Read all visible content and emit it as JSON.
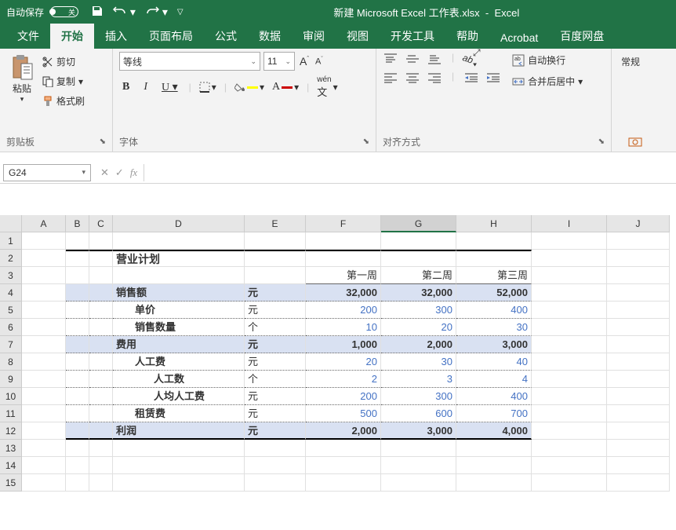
{
  "titleBar": {
    "autosave": "自动保存",
    "toggleState": "关",
    "filename": "新建 Microsoft Excel 工作表.xlsx",
    "appName": "Excel"
  },
  "tabs": [
    "文件",
    "开始",
    "插入",
    "页面布局",
    "公式",
    "数据",
    "审阅",
    "视图",
    "开发工具",
    "帮助",
    "Acrobat",
    "百度网盘"
  ],
  "activeTab": "开始",
  "ribbon": {
    "clipboard": {
      "paste": "粘贴",
      "cut": "剪切",
      "copy": "复制",
      "format": "格式刷",
      "label": "剪贴板"
    },
    "font": {
      "name": "等线",
      "size": "11",
      "label": "字体",
      "wen": "wén"
    },
    "alignment": {
      "wrap": "自动换行",
      "merge": "合并后居中",
      "label": "对齐方式"
    },
    "number": {
      "format": "常规"
    }
  },
  "nameBox": "G24",
  "colHeaders": [
    "A",
    "B",
    "C",
    "D",
    "E",
    "F",
    "G",
    "H",
    "I",
    "J"
  ],
  "rowCount": 15,
  "sheet": {
    "title": "营业计划",
    "weekHeaders": [
      "第一周",
      "第二周",
      "第三周"
    ],
    "rows": [
      {
        "label": "销售额",
        "unit": "元",
        "vals": [
          "32,000",
          "32,000",
          "52,000"
        ],
        "type": "section"
      },
      {
        "label": "单价",
        "unit": "元",
        "vals": [
          "200",
          "300",
          "400"
        ],
        "type": "indent1",
        "blue": true
      },
      {
        "label": "销售数量",
        "unit": "个",
        "vals": [
          "10",
          "20",
          "30"
        ],
        "type": "indent1",
        "blue": true
      },
      {
        "label": "费用",
        "unit": "元",
        "vals": [
          "1,000",
          "2,000",
          "3,000"
        ],
        "type": "section"
      },
      {
        "label": "人工费",
        "unit": "元",
        "vals": [
          "20",
          "30",
          "40"
        ],
        "type": "indent1",
        "blue": true
      },
      {
        "label": "人工数",
        "unit": "个",
        "vals": [
          "2",
          "3",
          "4"
        ],
        "type": "indent2",
        "blue": true
      },
      {
        "label": "人均人工费",
        "unit": "元",
        "vals": [
          "200",
          "300",
          "400"
        ],
        "type": "indent2",
        "blue": true
      },
      {
        "label": "租赁费",
        "unit": "元",
        "vals": [
          "500",
          "600",
          "700"
        ],
        "type": "indent1",
        "blue": true
      },
      {
        "label": "利润",
        "unit": "元",
        "vals": [
          "2,000",
          "3,000",
          "4,000"
        ],
        "type": "section",
        "bottom": true
      }
    ]
  }
}
